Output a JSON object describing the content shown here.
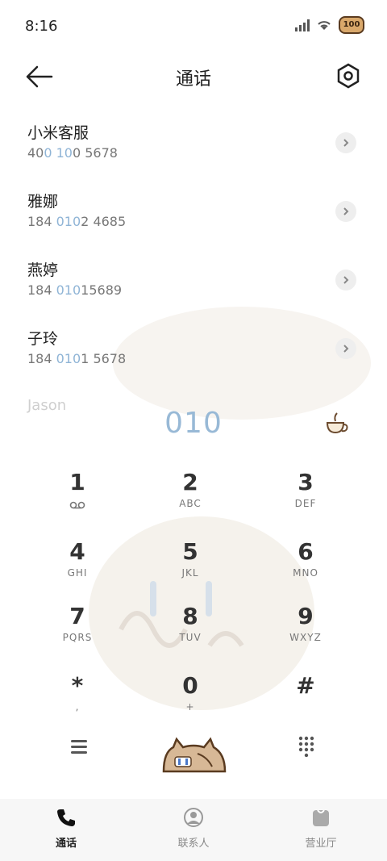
{
  "status_bar": {
    "time": "8:16",
    "battery": "100"
  },
  "header": {
    "title": "通话"
  },
  "contacts": [
    {
      "name": "小米客服",
      "num_parts": [
        "40",
        "0 10",
        "0 5678"
      ]
    },
    {
      "name": "雅娜",
      "num_parts": [
        "184 ",
        "010",
        "2 4685"
      ]
    },
    {
      "name": "燕婷",
      "num_parts": [
        "184 ",
        "010",
        "15689"
      ]
    },
    {
      "name": "子玲",
      "num_parts": [
        "184 ",
        "010",
        "1 5678"
      ]
    }
  ],
  "faded_contact": "Jason",
  "dialed_number": "010",
  "keypad": [
    {
      "digit": "1",
      "letters": ""
    },
    {
      "digit": "2",
      "letters": "ABC"
    },
    {
      "digit": "3",
      "letters": "DEF"
    },
    {
      "digit": "4",
      "letters": "GHI"
    },
    {
      "digit": "5",
      "letters": "JKL"
    },
    {
      "digit": "6",
      "letters": "MNO"
    },
    {
      "digit": "7",
      "letters": "PQRS"
    },
    {
      "digit": "8",
      "letters": "TUV"
    },
    {
      "digit": "9",
      "letters": "WXYZ"
    },
    {
      "digit": "*",
      "letters": ","
    },
    {
      "digit": "0",
      "letters": "+"
    },
    {
      "digit": "#",
      "letters": ""
    }
  ],
  "nav": [
    {
      "label": "通话",
      "icon": "phone-icon",
      "active": true
    },
    {
      "label": "联系人",
      "icon": "contact-icon",
      "active": false
    },
    {
      "label": "营业厅",
      "icon": "bag-icon",
      "active": false
    }
  ],
  "colors": {
    "highlight": "#8fb4d6",
    "dialed": "#98b9d6"
  }
}
